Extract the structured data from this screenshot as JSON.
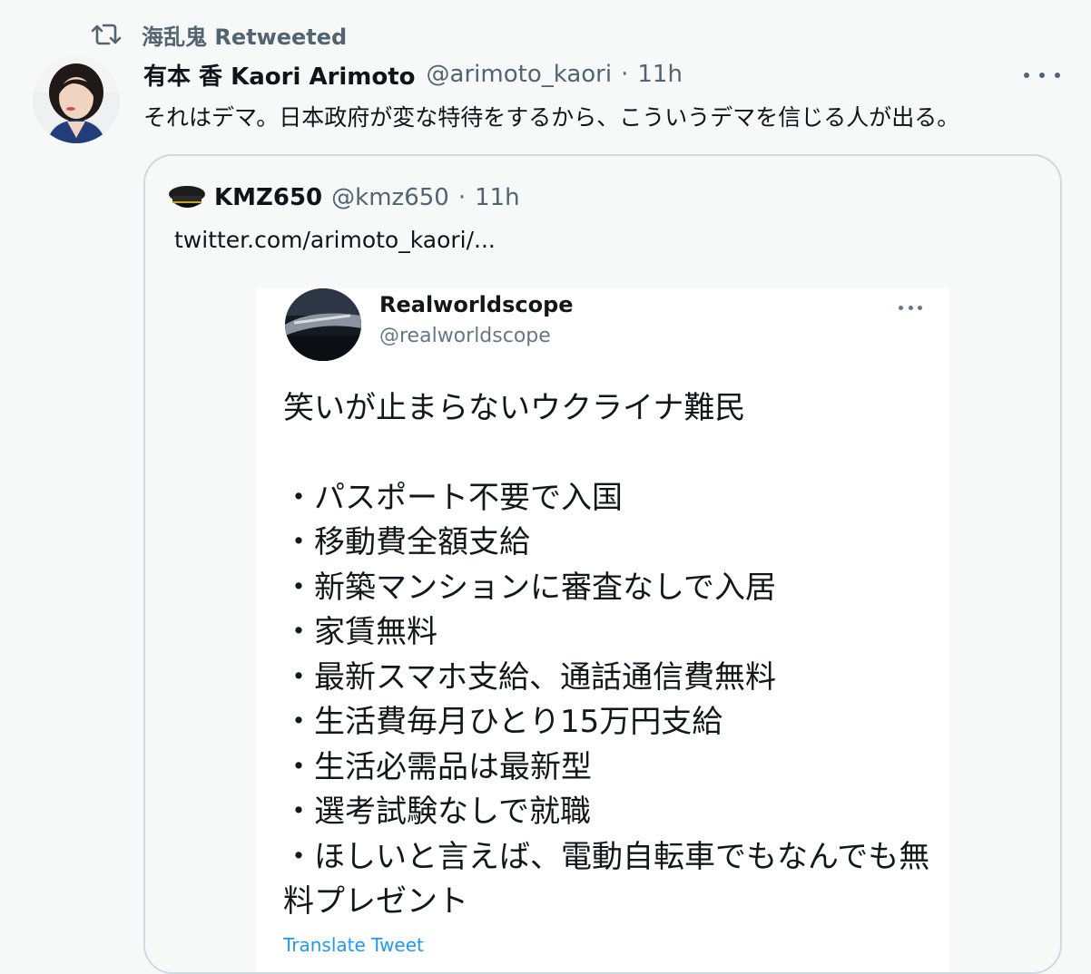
{
  "retweet": {
    "icon": "retweet-icon",
    "label": "海乱鬼 Retweeted"
  },
  "tweet": {
    "avatar": "profile-avatar",
    "name": "有本 香 Kaori Arimoto",
    "handle": "@arimoto_kaori",
    "separator": "·",
    "time": "11h",
    "more_icon": "more-icon",
    "text": "それはデマ。日本政府が変な特待をするから、こういうデマを信じる人が出る。"
  },
  "quote": {
    "avatar": "captain-hat-icon",
    "name": "KMZ650",
    "handle": "@kmz650",
    "separator": "·",
    "time": "11h",
    "link_text": "twitter.com/arimoto_kaori/..."
  },
  "embedded_screenshot": {
    "name": "Realworldscope",
    "handle": "@realworldscope",
    "more_icon": "more-icon",
    "heading": "笑いが止まらないウクライナ難民",
    "items": [
      "・パスポート不要で入国",
      "・移動費全額支給",
      "・新築マンションに審査なしで入居",
      "・家賃無料",
      "・最新スマホ支給、通話通信費無料",
      "・生活費毎月ひとり15万円支給",
      "・生活必需品は最新型",
      "・選考試験なしで就職",
      "・ほしいと言えば、電動自転車でもなんでも無料プレゼント"
    ],
    "translate": "Translate Tweet"
  },
  "colors": {
    "background": "#f7f9f9",
    "secondary_text": "#536471",
    "border": "#cfd9de",
    "link_blue": "#1d9bf0"
  }
}
